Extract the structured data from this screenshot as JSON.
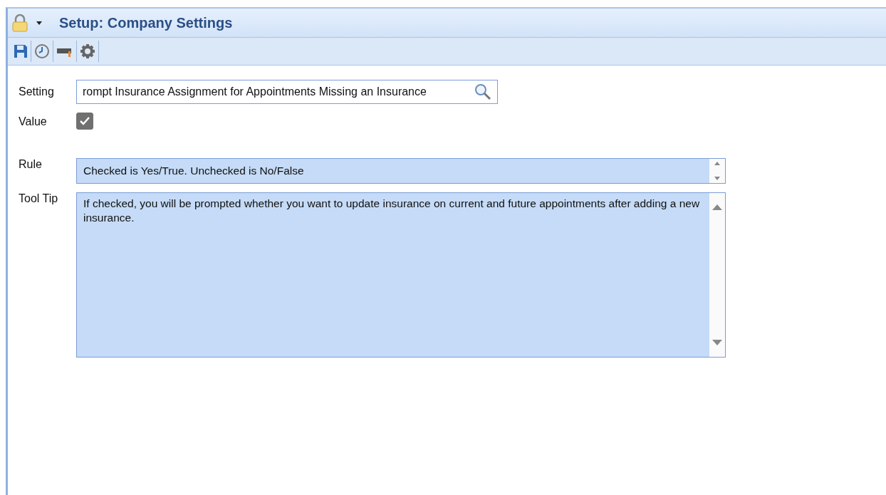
{
  "window": {
    "title": "Setup: Company Settings"
  },
  "toolbar": {
    "buttons": [
      {
        "kind": "save"
      },
      {
        "kind": "history"
      },
      {
        "kind": "training"
      },
      {
        "kind": "settings"
      }
    ]
  },
  "form": {
    "setting": {
      "label": "Setting",
      "value": "rompt Insurance Assignment for Appointments Missing an Insurance"
    },
    "value": {
      "label": "Value",
      "checked": true
    },
    "rule": {
      "label": "Rule",
      "value": "Checked is Yes/True. Unchecked is No/False"
    },
    "tool_tip": {
      "label": "Tool Tip",
      "value": "If checked, you will be prompted whether you want to update insurance on current and future appointments after adding a new insurance."
    }
  }
}
